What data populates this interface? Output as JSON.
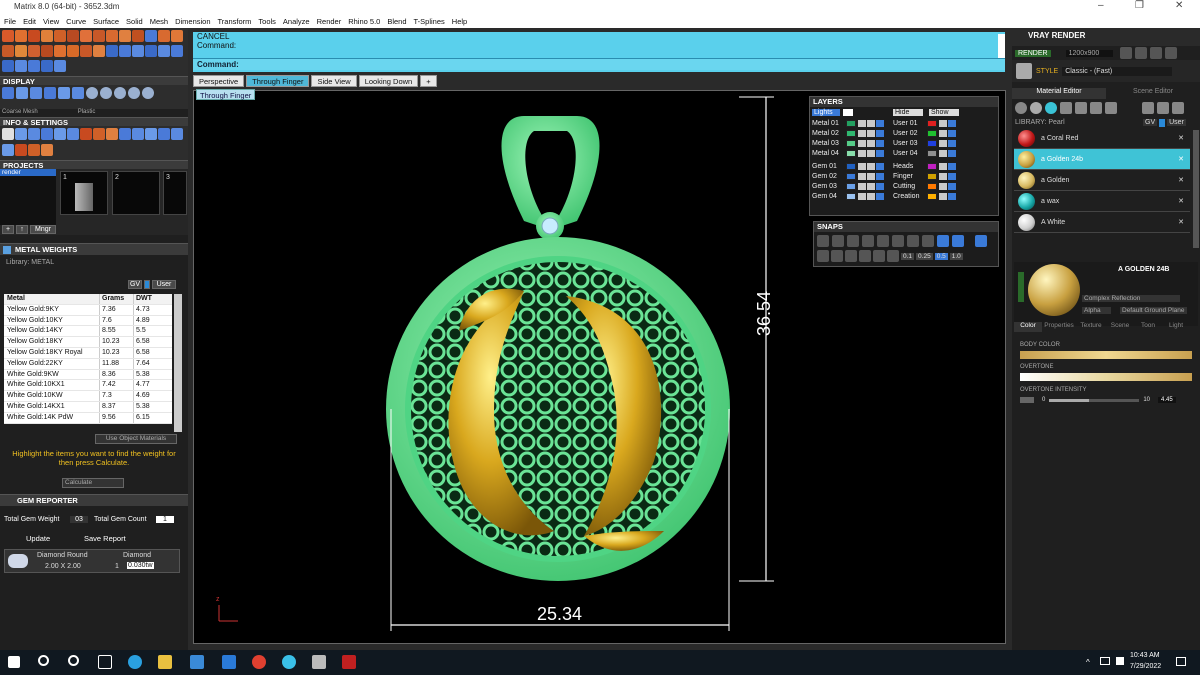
{
  "app": {
    "title": "Matrix 8.0 (64-bit) - 3652.3dm"
  },
  "menu": [
    "File",
    "Edit",
    "View",
    "Curve",
    "Surface",
    "Solid",
    "Mesh",
    "Dimension",
    "Transform",
    "Tools",
    "Analyze",
    "Render",
    "Rhino 5.0",
    "Blend",
    "T-Splines",
    "Help"
  ],
  "left": {
    "display": "DISPLAY",
    "display_sub1": "Coarse Mesh",
    "display_sub2": "Plastic",
    "info": "INFO & SETTINGS",
    "projects": "PROJECTS",
    "project_item": "render",
    "slots": [
      "1",
      "2",
      "3"
    ],
    "manager": "Mngr",
    "metal_weights": "METAL WEIGHTS",
    "library_label": "Library: METAL",
    "gv": "GV",
    "user": "User",
    "columns": [
      "Metal",
      "Grams",
      "DWT"
    ],
    "rows": [
      [
        "Yellow Gold:9KY",
        "7.36",
        "4.73"
      ],
      [
        "Yellow Gold:10KY",
        "7.6",
        "4.89"
      ],
      [
        "Yellow Gold:14KY",
        "8.55",
        "5.5"
      ],
      [
        "Yellow Gold:18KY",
        "10.23",
        "6.58"
      ],
      [
        "Yellow Gold:18KY Royal",
        "10.23",
        "6.58"
      ],
      [
        "Yellow Gold:22KY",
        "11.88",
        "7.64"
      ],
      [
        "White Gold:9KW",
        "8.36",
        "5.38"
      ],
      [
        "White Gold:10KX1",
        "7.42",
        "4.77"
      ],
      [
        "White Gold:10KW",
        "7.3",
        "4.69"
      ],
      [
        "White Gold:14KX1",
        "8.37",
        "5.38"
      ],
      [
        "White Gold:14K PdW",
        "9.56",
        "6.15"
      ]
    ],
    "use_object": "Use Object Materials",
    "hint": "Highlight the items you want to find the weight for then press Calculate.",
    "calculate": "Calculate",
    "gem_reporter": "GEM REPORTER",
    "total_weight_label": "Total Gem Weight",
    "total_weight": "03",
    "total_count_label": "Total Gem Count",
    "total_count": "1",
    "update": "Update",
    "save_report": "Save Report",
    "gem_name": "Diamond Round",
    "gem_type": "Diamond",
    "gem_size": "2.00 X 2.00",
    "gem_qty": "1",
    "gem_ct": "0.030tw"
  },
  "command": {
    "line1": "CANCEL",
    "line2": "Command:",
    "prompt": "Command:"
  },
  "tabs": [
    "Perspective",
    "Through Finger",
    "Side View",
    "Looking Down",
    "+"
  ],
  "viewport": {
    "name": "Through Finger",
    "dim_height": "36.54",
    "dim_width": "25.34",
    "axis": "z"
  },
  "layers": {
    "title": "LAYERS",
    "lights": "Lights",
    "hide": "Hide",
    "show": "Show",
    "left": [
      {
        "n": "Metal 01",
        "c": "#22a060"
      },
      {
        "n": "Metal 02",
        "c": "#2fb870"
      },
      {
        "n": "Metal 03",
        "c": "#55cc88"
      },
      {
        "n": "Metal 04",
        "c": "#88ddaa"
      },
      {
        "n": "Gem 01",
        "c": "#2060c0"
      },
      {
        "n": "Gem 02",
        "c": "#3a7ad8"
      },
      {
        "n": "Gem 03",
        "c": "#6aa0e8"
      },
      {
        "n": "Gem 04",
        "c": "#9bc2f0"
      }
    ],
    "right": [
      {
        "n": "User 01",
        "c": "#e02020"
      },
      {
        "n": "User 02",
        "c": "#20c030"
      },
      {
        "n": "User 03",
        "c": "#2040e0"
      },
      {
        "n": "User 04",
        "c": "#909090"
      },
      {
        "n": "Heads",
        "c": "#c020c0"
      },
      {
        "n": "Finger",
        "c": "#d0a000"
      },
      {
        "n": "Cutting",
        "c": "#ff7a00"
      },
      {
        "n": "Creation",
        "c": "#ffb000"
      }
    ]
  },
  "snaps": {
    "title": "SNAPS",
    "vals": [
      "0.1",
      "0.25",
      "0.5",
      "1.0"
    ]
  },
  "vray": {
    "title": "VRAY RENDER",
    "render": "RENDER",
    "res": "1200x900",
    "style_label": "STYLE",
    "style": "Classic - (Fast)",
    "tab1": "Material Editor",
    "tab2": "Scene Editor",
    "library": "LIBRARY: Pearl",
    "gv": "GV",
    "user": "User",
    "materials": [
      {
        "n": "a Coral Red",
        "c": "#c01818"
      },
      {
        "n": "a Golden 24b",
        "c": "#c8a040"
      },
      {
        "n": "a Golden",
        "c": "#d6b860"
      },
      {
        "n": "a wax",
        "c": "#18a8a8"
      },
      {
        "n": "A White",
        "c": "#e0e0e0"
      }
    ],
    "preview_name": "A GOLDEN 24B",
    "reflection": "Complex Reflection",
    "alpha": "Alpha",
    "ground": "Default Ground Plane",
    "subtabs": [
      "Color",
      "Properties",
      "Texture",
      "Scene",
      "Toon",
      "Light"
    ],
    "body_color": "BODY COLOR",
    "overtone": "OVERTONE",
    "intensity": "OVERTONE INTENSITY",
    "int_min": "0",
    "int_max": "10",
    "int_val": "4.45"
  },
  "taskbar": {
    "time": "10:43 AM",
    "date": "7/29/2022"
  }
}
